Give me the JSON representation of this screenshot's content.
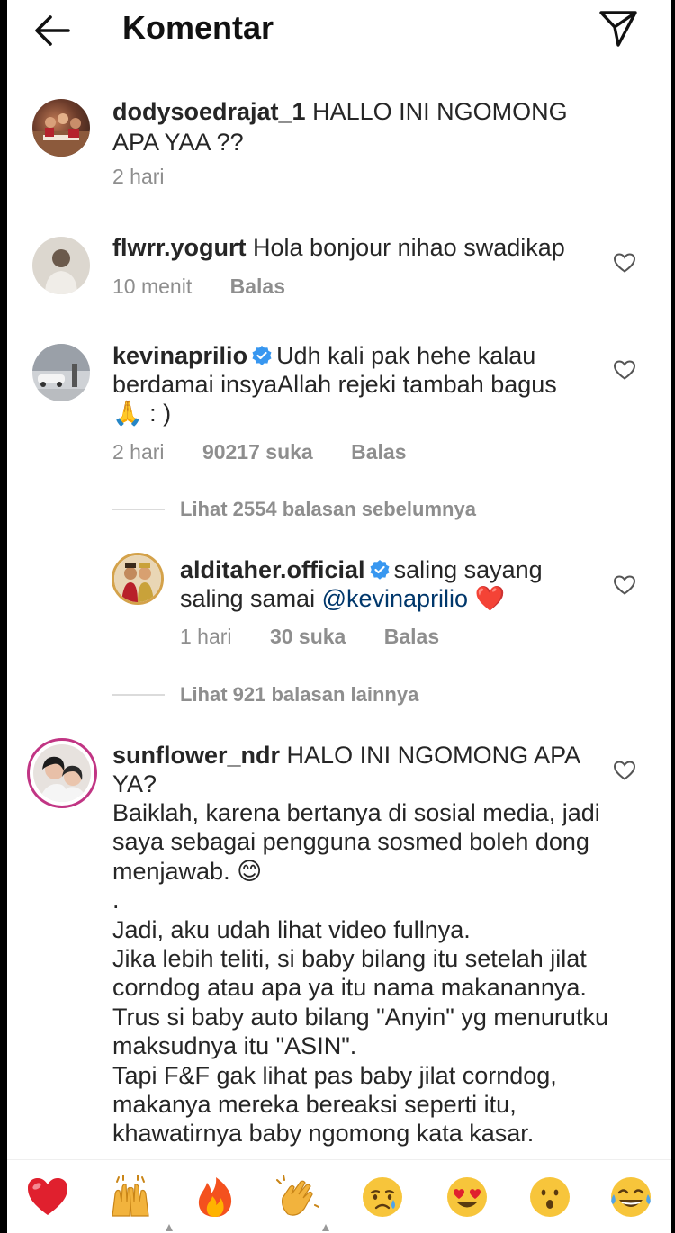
{
  "header": {
    "title": "Komentar",
    "back_icon": "arrow-left-icon",
    "send_icon": "paper-plane-icon"
  },
  "caption": {
    "username": "dodysoedrajat_1",
    "text": "HALLO INI NGOMONG APA YAA ??",
    "time": "2 hari"
  },
  "comments": [
    {
      "username": "flwrr.yogurt",
      "verified": false,
      "text": "Hola bonjour nihao swadikap",
      "time": "10 menit",
      "likes": "",
      "reply": "Balas"
    },
    {
      "username": "kevinaprilio",
      "verified": true,
      "text": "Udh kali pak hehe kalau berdamai insyaAllah rejeki tambah bagus 🙏 : )",
      "time": "2 hari",
      "likes": "90217 suka",
      "reply": "Balas"
    }
  ],
  "view_previous": "Lihat 2554 balasan sebelumnya",
  "reply": {
    "username": "alditaher.official",
    "verified": true,
    "text_before": "saling sayang saling samai",
    "mention": "@kevinaprilio",
    "emoji": "❤️",
    "time": "1 hari",
    "likes": "30 suka",
    "reply": "Balas"
  },
  "view_more": "Lihat 921 balasan lainnya",
  "long_comment": {
    "username": "sunflower_ndr",
    "first_line": "HALO INI NGOMONG APA YA?",
    "body": "Baiklah, karena bertanya di sosial media, jadi saya sebagai pengguna sosmed boleh dong menjawab. 😊\n.\nJadi, aku udah lihat video fullnya.\nJika lebih teliti, si baby bilang itu setelah jilat corndog atau apa ya itu nama makanannya.\nTrus si baby auto bilang \"Anyin\" yg menurutku maksudnya itu \"ASIN\".\nTapi F&F gak lihat pas baby jilat corndog, makanya mereka bereaksi seperti itu, khawatirnya baby ngomong kata kasar."
  },
  "emoji_bar": [
    "❤️",
    "🙌",
    "🔥",
    "👏",
    "😢",
    "😍",
    "😮",
    "😂"
  ],
  "colors": {
    "heart_red": "#ed4956",
    "verified_blue": "#3897f0",
    "link": "#00376b",
    "meta_gray": "#8e8e8e"
  }
}
